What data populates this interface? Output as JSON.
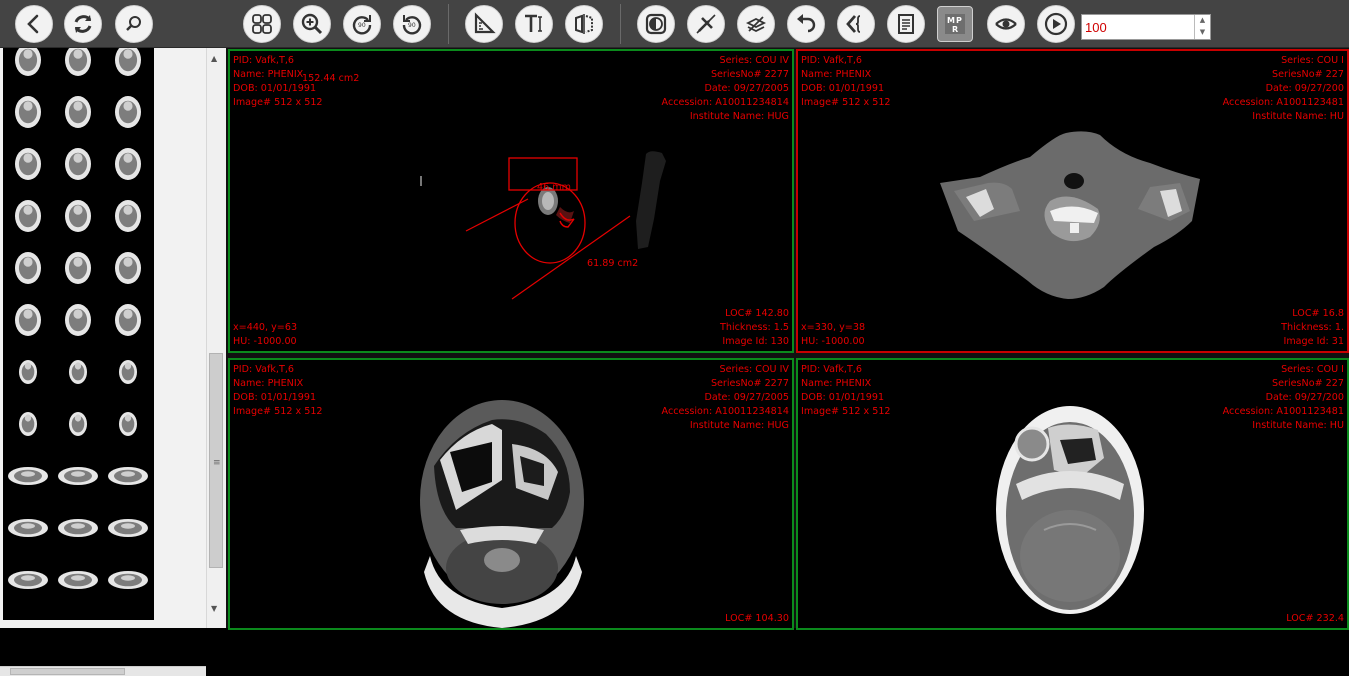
{
  "toolbar": {
    "buttons": [
      {
        "name": "back-button",
        "icon": "chevron-left-icon"
      },
      {
        "name": "refresh-button",
        "icon": "refresh-icon"
      },
      {
        "name": "search-button",
        "icon": "magnifier-icon"
      },
      {
        "name": "layout-button",
        "icon": "grid-icon"
      },
      {
        "name": "zoom-button",
        "icon": "zoom-in-icon"
      },
      {
        "name": "rotate-right-button",
        "icon": "rotate-right-icon"
      },
      {
        "name": "rotate-left-button",
        "icon": "rotate-left-icon"
      },
      {
        "name": "measure-button",
        "icon": "ruler-triangle-icon"
      },
      {
        "name": "text-annotation-button",
        "icon": "text-cursor-icon"
      },
      {
        "name": "flip-button",
        "icon": "flip-icon"
      },
      {
        "name": "window-level-button",
        "icon": "contrast-icon"
      },
      {
        "name": "clear-button",
        "icon": "tools-off-icon"
      },
      {
        "name": "layers-button",
        "icon": "layers-icon"
      },
      {
        "name": "undo-button",
        "icon": "undo-icon"
      },
      {
        "name": "cine-button",
        "icon": "code-brackets-icon"
      },
      {
        "name": "report-button",
        "icon": "document-icon"
      },
      {
        "name": "mpr-button",
        "icon": "mpr-icon"
      },
      {
        "name": "3d-button",
        "icon": "eye-orbit-icon"
      },
      {
        "name": "play-button",
        "icon": "play-icon"
      }
    ],
    "zoom_value": "100"
  },
  "viewports": [
    {
      "border": "#0b8a1c",
      "top_left": [
        "PID: Vafk,T,6",
        "Name: PHENIX",
        "DOB: 01/01/1991",
        "Image# 512 x 512"
      ],
      "top_right": [
        "Series: COU IV",
        "SeriesNo# 2277",
        "Date: 09/27/2005",
        "Accession: A10011234814",
        "Institute Name: HUG"
      ],
      "bottom_left": [
        "x=440, y=63",
        "HU: -1000.00"
      ],
      "bottom_right": [
        "LOC# 142.80",
        "Thickness: 1.5",
        "Image Id: 130"
      ],
      "measurements": [
        "152.44 cm2",
        "46 mm",
        "61.89 cm2"
      ]
    },
    {
      "border": "#c80000",
      "top_left": [
        "PID: Vafk,T,6",
        "Name: PHENIX",
        "DOB: 01/01/1991",
        "Image# 512 x 512"
      ],
      "top_right": [
        "Series: COU I",
        "SeriesNo# 227",
        "Date: 09/27/200",
        "Accession: A1001123481",
        "Institute Name: HU"
      ],
      "bottom_left": [
        "x=330, y=38",
        "HU: -1000.00"
      ],
      "bottom_right": [
        "LOC# 16.8",
        "Thickness: 1.",
        "Image Id: 31"
      ]
    },
    {
      "border": "#0b8a1c",
      "top_left": [
        "PID: Vafk,T,6",
        "Name: PHENIX",
        "DOB: 01/01/1991",
        "Image# 512 x 512"
      ],
      "top_right": [
        "Series: COU IV",
        "SeriesNo# 2277",
        "Date: 09/27/2005",
        "Accession: A10011234814",
        "Institute Name: HUG"
      ],
      "bottom_right": [
        "LOC# 104.30"
      ]
    },
    {
      "border": "#0b8a1c",
      "top_left": [
        "PID: Vafk,T,6",
        "Name: PHENIX",
        "DOB: 01/01/1991",
        "Image# 512 x 512"
      ],
      "top_right": [
        "Series: COU I",
        "SeriesNo# 227",
        "Date: 09/27/200",
        "Accession: A1001123481",
        "Institute Name: HU"
      ],
      "bottom_right": [
        "LOC# 232.4"
      ]
    }
  ]
}
